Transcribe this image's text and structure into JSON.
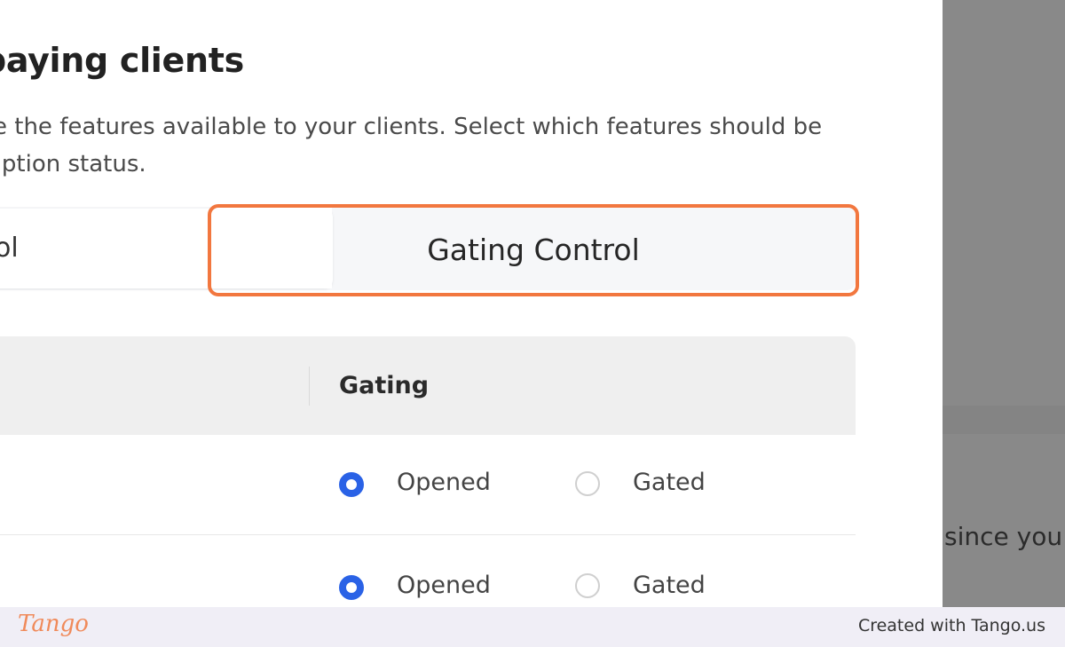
{
  "modal": {
    "title": "paying clients",
    "description_line1": "e the features available to your clients. Select which features should be",
    "description_line2": "ription status."
  },
  "tabs": {
    "first_tab_label": "ol",
    "gating_tab_label": "Gating Control"
  },
  "table": {
    "column_header": "Gating",
    "rows": [
      {
        "option_opened": "Opened",
        "option_gated": "Gated",
        "selected": "Opened"
      },
      {
        "option_opened": "Opened",
        "option_gated": "Gated",
        "selected": "Opened"
      }
    ]
  },
  "backdrop": {
    "partial_text": "since you"
  },
  "footer": {
    "logo": "Tango",
    "credit": "Created with Tango.us"
  },
  "colors": {
    "highlight": "#f2773f",
    "radio_selected": "#2a62e6",
    "backdrop": "#898989"
  }
}
